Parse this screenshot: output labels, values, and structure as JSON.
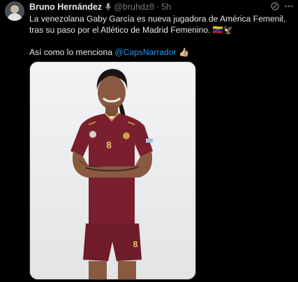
{
  "tweet": {
    "author_name": "Bruno Hernández",
    "handle": "@bruhdz8",
    "separator": "·",
    "time": "5h",
    "text_line1": "La venezolana Gaby García es nueva jugadora de América Femenil, tras su paso por el Atlético de Madrid Femenino.",
    "text_emojis": "🇻🇪🦅",
    "text_line2_prefix": "Así como lo menciona ",
    "mention": "@CapsNarrador",
    "text_line2_emoji": "👍🏼",
    "media_alt": "Player in burgundy Venezuela kit number 8",
    "jersey_number": "8"
  },
  "icons": {
    "header_badge": "microphone-icon",
    "grok": "grok-icon",
    "more": "more-options-icon"
  },
  "colors": {
    "background": "#000000",
    "text": "#e7e9ea",
    "secondary": "#71767b",
    "link": "#1d9bf0",
    "kit": "#7a1f2e"
  }
}
